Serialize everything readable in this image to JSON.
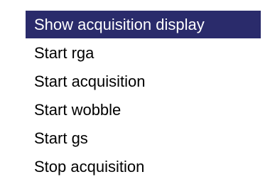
{
  "menu": {
    "items": [
      {
        "label": "Show acquisition display",
        "selected": true
      },
      {
        "label": "Start rga",
        "selected": false
      },
      {
        "label": "Start acquisition",
        "selected": false
      },
      {
        "label": "Start wobble",
        "selected": false
      },
      {
        "label": "Start gs",
        "selected": false
      },
      {
        "label": "Stop acquisition",
        "selected": false
      }
    ]
  },
  "colors": {
    "selected_background": "#2a2b6b",
    "selected_text": "#ffffff",
    "text": "#000000",
    "background": "#ffffff"
  }
}
